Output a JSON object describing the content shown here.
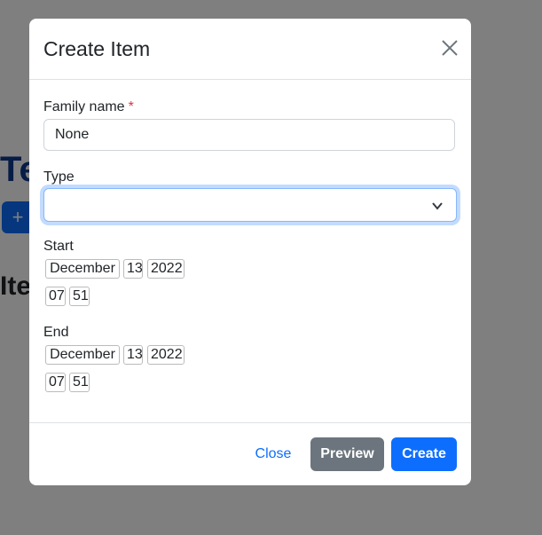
{
  "background": {
    "title_fragment": "Te",
    "add_button_glyph": "+",
    "heading_fragment": "Ite"
  },
  "modal": {
    "title": "Create Item",
    "fields": {
      "family_name": {
        "label": "Family name",
        "required_mark": "*",
        "value": "None"
      },
      "type": {
        "label": "Type",
        "value": ""
      },
      "start": {
        "label": "Start",
        "month": "December",
        "day": "13",
        "year": "2022",
        "hour": "07",
        "minute": "51"
      },
      "end": {
        "label": "End",
        "month": "December",
        "day": "13",
        "year": "2022",
        "hour": "07",
        "minute": "51"
      }
    },
    "footer": {
      "close_label": "Close",
      "preview_label": "Preview",
      "create_label": "Create"
    }
  },
  "colors": {
    "primary": "#0d6efd",
    "secondary": "#6c757d",
    "required": "#dc3545",
    "backdrop": "rgba(0,0,0,0.5)"
  },
  "icons": {
    "close": "close-icon",
    "select_caret": "chevron-down-icon"
  }
}
